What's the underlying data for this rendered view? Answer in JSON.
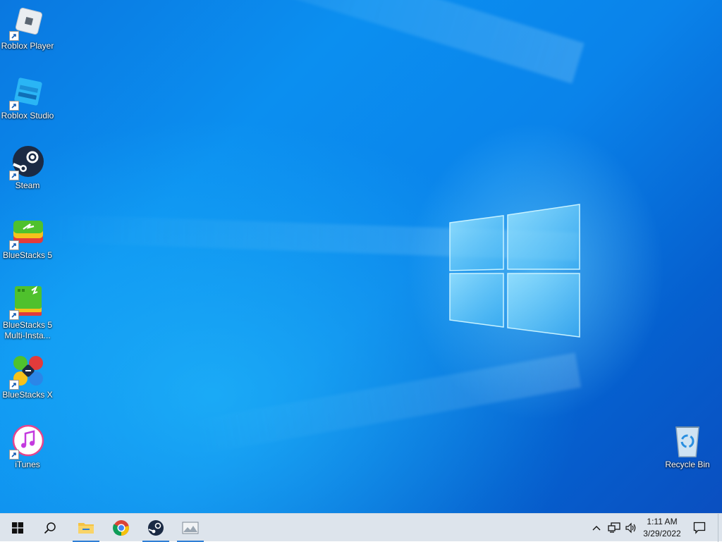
{
  "desktop": {
    "icons": [
      {
        "label": "Roblox Player",
        "icon": "roblox-player-icon"
      },
      {
        "label": "Roblox Studio",
        "icon": "roblox-studio-icon"
      },
      {
        "label": "Steam",
        "icon": "steam-icon"
      },
      {
        "label": "BlueStacks 5",
        "icon": "bluestacks5-icon"
      },
      {
        "label": "BlueStacks 5 Multi-Insta...",
        "icon": "bluestacks5-multi-instance-icon"
      },
      {
        "label": "BlueStacks X",
        "icon": "bluestacks-x-icon"
      },
      {
        "label": "iTunes",
        "icon": "itunes-icon"
      },
      {
        "label": "Recycle Bin",
        "icon": "recycle-bin-icon"
      }
    ]
  },
  "taskbar": {
    "start": "windows-logo-icon",
    "search": "search-icon",
    "pinned": [
      {
        "name": "file-explorer-icon"
      },
      {
        "name": "chrome-icon"
      },
      {
        "name": "steam-icon"
      },
      {
        "name": "image-viewer-icon"
      }
    ],
    "tray": {
      "chevron": "chevron-up-icon",
      "network": "network-icon",
      "volume": "volume-icon",
      "time": "1:11 AM",
      "date": "3/29/2022",
      "notifications": "action-center-icon"
    },
    "colors": {
      "background": "#dde4ec",
      "active_indicator": "#2f7fd6"
    }
  },
  "wallpaper": {
    "colors": {
      "primary": "#0a83ea",
      "dark": "#0a4fc0",
      "light": "#6fd6ff"
    }
  }
}
